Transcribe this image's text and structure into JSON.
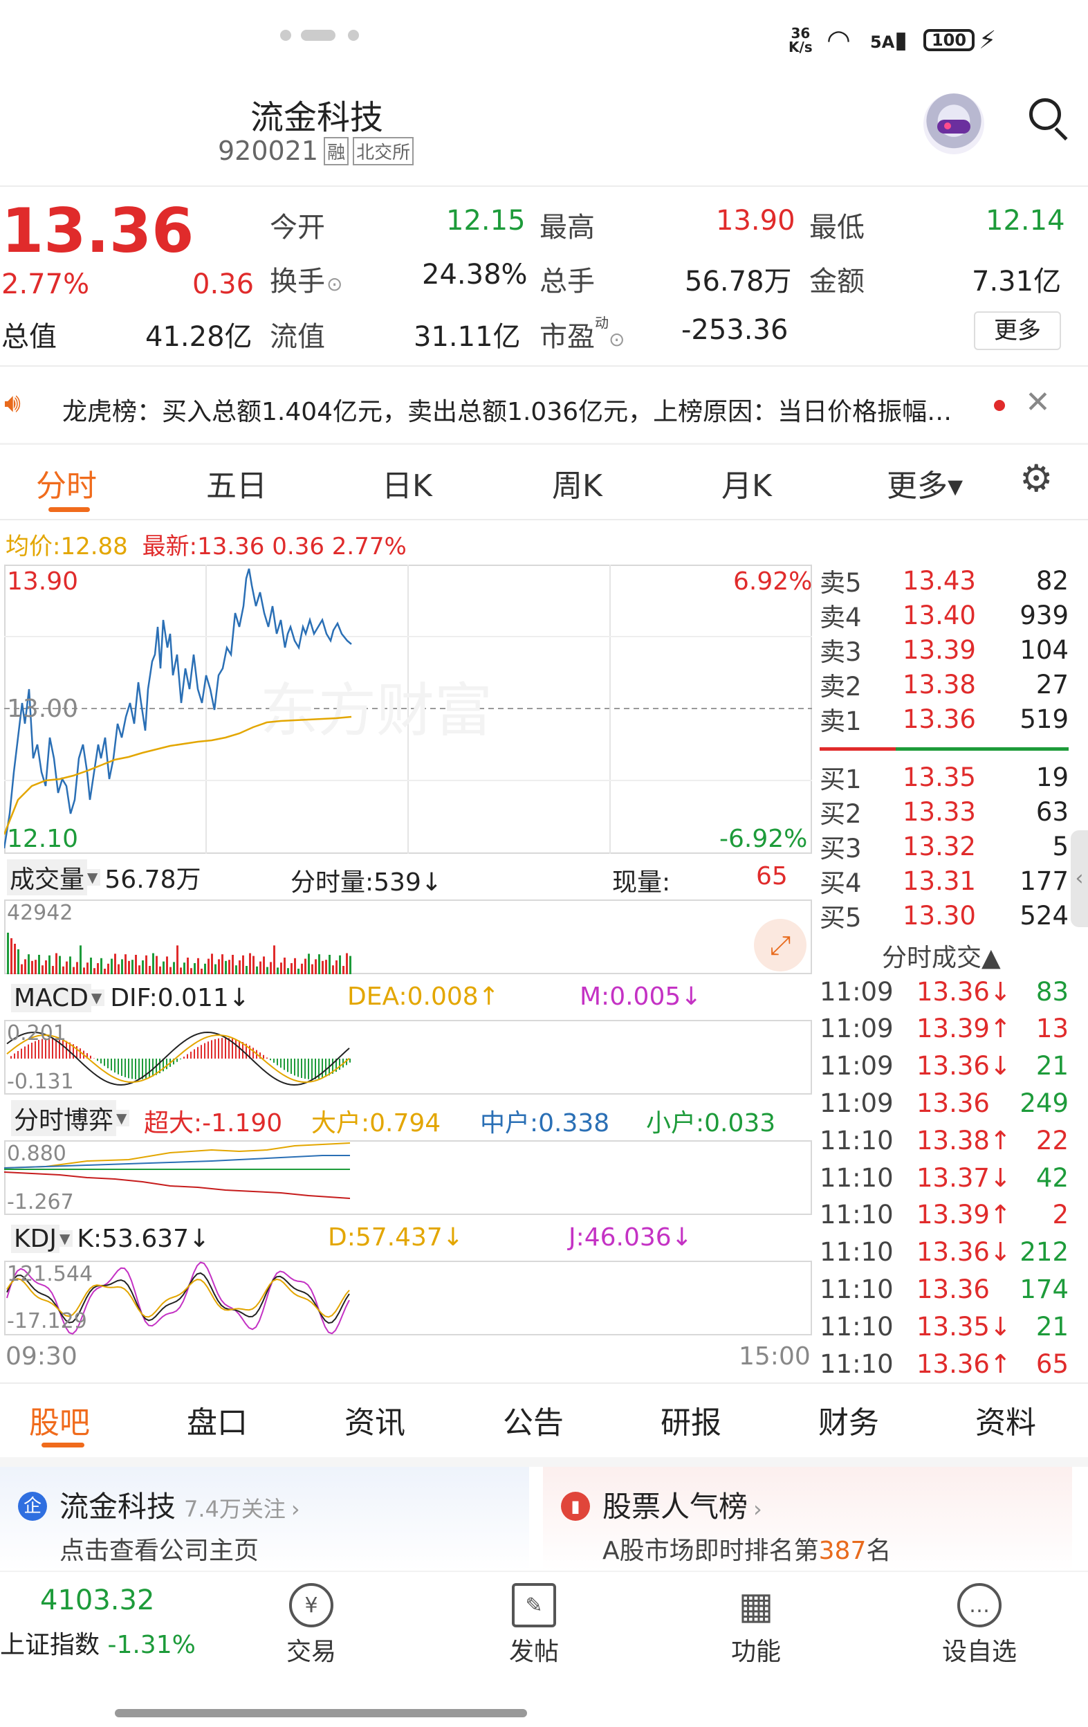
{
  "status_bar": {
    "speed_top": "36",
    "speed_bottom": "K/s",
    "network": "5A",
    "battery": "100"
  },
  "header": {
    "title": "流金科技",
    "code": "920021",
    "badge_margin": "融",
    "badge_exchange": "北交所"
  },
  "quote": {
    "price": "13.36",
    "change_pct": "2.77%",
    "change": "0.36",
    "total_value_label": "总值",
    "total_value": "41.28亿",
    "open_label": "今开",
    "open": "12.15",
    "high_label": "最高",
    "high": "13.90",
    "low_label": "最低",
    "low": "12.14",
    "turnover_label": "换手",
    "turnover": "24.38%",
    "volume_label": "总手",
    "volume": "56.78万",
    "amount_label": "金额",
    "amount": "7.31亿",
    "float_label": "流值",
    "float_value": "31.11亿",
    "pe_label": "市盈",
    "pe_sup": "动",
    "pe": "-253.36",
    "more_button": "更多"
  },
  "notice": {
    "text": "龙虎榜：买入总额1.404亿元，卖出总额1.036亿元，上榜原因：当日价格振幅…"
  },
  "chart_tabs": [
    "分时",
    "五日",
    "日K",
    "周K",
    "月K",
    "更多▾"
  ],
  "summary_line": {
    "avg_label": "均价:",
    "avg": "12.88",
    "latest_label": "最新:",
    "latest": "13.36",
    "chg": "0.36",
    "pct": "2.77%"
  },
  "price_chart": {
    "top_price": "13.90",
    "mid_price": "13.00",
    "bottom_price": "12.10",
    "top_pct": "6.92%",
    "bottom_pct": "-6.92%",
    "watermark": "东方财富"
  },
  "volume_bar": {
    "selector": "成交量",
    "total": "56.78万",
    "tick_label": "分时量:",
    "tick_value": "539↓",
    "now_label": "现量:",
    "now_value": "65",
    "max_label": "42942"
  },
  "macd": {
    "selector": "MACD",
    "dif": "DIF:0.011↓",
    "dea": "DEA:0.008↑",
    "m": "M:0.005↓",
    "top": "0.201",
    "bottom": "-0.131"
  },
  "fund_flow": {
    "selector": "分时博弈",
    "super": "超大:-1.190",
    "large": "大户:0.794",
    "medium": "中户:0.338",
    "small": "小户:0.033",
    "top": "0.880",
    "bottom": "-1.267"
  },
  "kdj": {
    "selector": "KDJ",
    "k": "K:53.637↓",
    "d": "D:57.437↓",
    "j": "J:46.036↓",
    "top": "121.544",
    "bottom": "-17.129"
  },
  "time_axis": {
    "start": "09:30",
    "end": "15:00"
  },
  "order_book": {
    "asks": [
      {
        "label": "卖5",
        "price": "13.43",
        "vol": "82"
      },
      {
        "label": "卖4",
        "price": "13.40",
        "vol": "939"
      },
      {
        "label": "卖3",
        "price": "13.39",
        "vol": "104"
      },
      {
        "label": "卖2",
        "price": "13.38",
        "vol": "27"
      },
      {
        "label": "卖1",
        "price": "13.36",
        "vol": "519"
      }
    ],
    "bids": [
      {
        "label": "买1",
        "price": "13.35",
        "vol": "19"
      },
      {
        "label": "买2",
        "price": "13.33",
        "vol": "63"
      },
      {
        "label": "买3",
        "price": "13.32",
        "vol": "5"
      },
      {
        "label": "买4",
        "price": "13.31",
        "vol": "177"
      },
      {
        "label": "买5",
        "price": "13.30",
        "vol": "524"
      }
    ]
  },
  "trades": {
    "title": "分时成交▲",
    "rows": [
      {
        "time": "11:09",
        "price": "13.36↓",
        "vol": "83",
        "dir": "down"
      },
      {
        "time": "11:09",
        "price": "13.39↑",
        "vol": "13",
        "dir": "up"
      },
      {
        "time": "11:09",
        "price": "13.36↓",
        "vol": "21",
        "dir": "down"
      },
      {
        "time": "11:09",
        "price": "13.36",
        "vol": "249",
        "dir": "flat"
      },
      {
        "time": "11:10",
        "price": "13.38↑",
        "vol": "22",
        "dir": "up"
      },
      {
        "time": "11:10",
        "price": "13.37↓",
        "vol": "42",
        "dir": "down"
      },
      {
        "time": "11:10",
        "price": "13.39↑",
        "vol": "2",
        "dir": "up"
      },
      {
        "time": "11:10",
        "price": "13.36↓",
        "vol": "212",
        "dir": "down"
      },
      {
        "time": "11:10",
        "price": "13.36",
        "vol": "174",
        "dir": "flat"
      },
      {
        "time": "11:10",
        "price": "13.35↓",
        "vol": "21",
        "dir": "down"
      },
      {
        "time": "11:10",
        "price": "13.36↑",
        "vol": "65",
        "dir": "up"
      }
    ]
  },
  "bottom_tabs": [
    "股吧",
    "盘口",
    "资讯",
    "公告",
    "研报",
    "财务",
    "资料"
  ],
  "cards": {
    "left_title": "流金科技",
    "left_follow": "7.4万关注",
    "left_sub": "点击查看公司主页",
    "left_badge": "企",
    "right_title": "股票人气榜",
    "right_sub_pre": "A股市场即时排名第",
    "right_rank": "387",
    "right_sub_post": "名"
  },
  "footer": {
    "index_value": "4103.32",
    "index_name": "上证指数",
    "index_pct": "-1.31%",
    "nav": [
      {
        "label": "交易",
        "icon": "¥"
      },
      {
        "label": "发帖",
        "icon": "✎"
      },
      {
        "label": "功能",
        "icon": "▦"
      },
      {
        "label": "设自选",
        "icon": "…"
      }
    ]
  }
}
